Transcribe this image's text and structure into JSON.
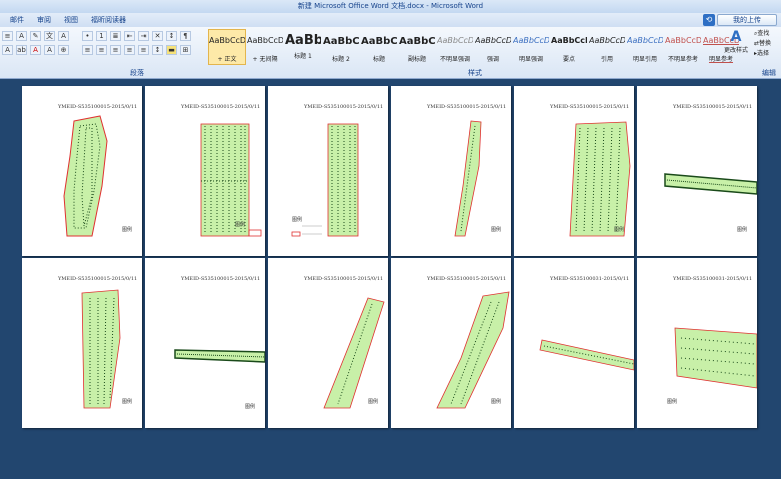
{
  "window": {
    "title": "新建 Microsoft Office Word 文档.docx - Microsoft Word"
  },
  "tabs": [
    "邮件",
    "审阅",
    "视图",
    "福昕阅读器"
  ],
  "share_button": "我的上传",
  "groups": {
    "paragraph": "段落",
    "styles": "样式",
    "editing": "编辑"
  },
  "styles": [
    {
      "sample": "AaBbCcDd",
      "name": "+ 正文"
    },
    {
      "sample": "AaBbCcDd",
      "name": "+ 无间隔"
    },
    {
      "sample": "AaBb",
      "name": "标题 1"
    },
    {
      "sample": "AaBbC",
      "name": "标题 2"
    },
    {
      "sample": "AaBbC",
      "name": "标题"
    },
    {
      "sample": "AaBbC",
      "name": "副标题"
    },
    {
      "sample": "AaBbCcDd",
      "name": "不明显强调"
    },
    {
      "sample": "AaBbCcDd",
      "name": "强调"
    },
    {
      "sample": "AaBbCcDd",
      "name": "明显强调"
    },
    {
      "sample": "AaBbCcDd",
      "name": "要点"
    },
    {
      "sample": "AaBbCcDd",
      "name": "引用"
    },
    {
      "sample": "AaBbCcDd",
      "name": "明显引用"
    },
    {
      "sample": "AaBbCcDd",
      "name": "不明显参考"
    },
    {
      "sample": "AaBbCcDd",
      "name": "明显参考"
    }
  ],
  "change_styles": "更改样式",
  "edit": {
    "find": "查找",
    "replace": "替换",
    "select": "选择"
  },
  "pages": [
    {
      "header": "YMEID-S535100015-2015/0/11",
      "legend": "图例"
    },
    {
      "header": "YMEID-S535100015-2015/0/11",
      "legend": "图例"
    },
    {
      "header": "YMEID-S535100015-2015/0/11",
      "legend": "图例"
    },
    {
      "header": "YMEID-S535100015-2015/0/11",
      "legend": "图例"
    },
    {
      "header": "YMEID-S535100015-2015/0/11",
      "legend": "图例"
    },
    {
      "header": "YMEID-S535100015-2015/0/11",
      "legend": "图例"
    },
    {
      "header": "YMEID-S535100015-2015/0/11",
      "legend": "图例"
    },
    {
      "header": "YMEID-S535100015-2015/0/11",
      "legend": "图例"
    },
    {
      "header": "YMEID-S535100015-2015/0/11",
      "legend": "图例"
    },
    {
      "header": "YMEID-S535100015-2015/0/11",
      "legend": "图例"
    },
    {
      "header": "YMEID-S535100031-2015/0/11",
      "legend": ""
    },
    {
      "header": "YMEID-S535100031-2015/0/11",
      "legend": "图例"
    }
  ],
  "colors": {
    "field_fill": "#c8f0a8",
    "field_border": "#e03030",
    "point": "#1a4a1a"
  }
}
